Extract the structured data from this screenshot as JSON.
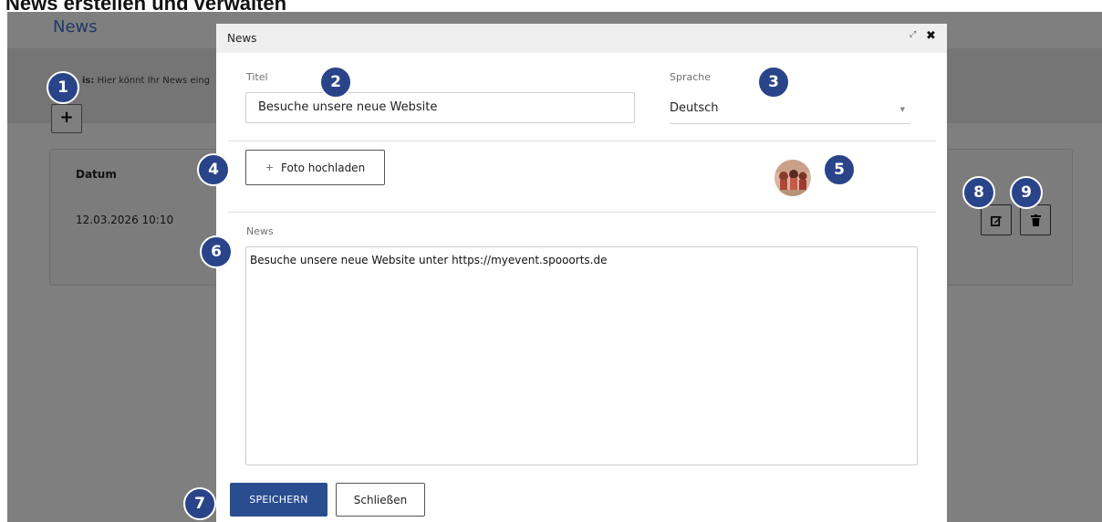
{
  "page": {
    "heading": "News erstellen und verwalten"
  },
  "background": {
    "title": "News",
    "hint_label": "is:",
    "hint_text": " Hier könnt Ihr News eing",
    "add_button_icon": "plus-icon",
    "table": {
      "column_header": "Datum",
      "rows": [
        {
          "date": "12.03.2026 10:10"
        }
      ]
    },
    "row_actions": {
      "edit_icon": "edit-icon",
      "delete_icon": "trash-icon"
    }
  },
  "modal": {
    "title": "News",
    "header_icons": [
      "external-link-icon",
      "close-icon"
    ],
    "fields": {
      "title_label": "Titel",
      "title_value": "Besuche unsere neue Website",
      "language_label": "Sprache",
      "language_value": "Deutsch",
      "news_label": "News",
      "news_value": "Besuche unsere neue Website unter https://myevent.spooorts.de"
    },
    "upload_button_label": "Foto hochladen",
    "save_button_label": "SPEICHERN",
    "close_button_label": "Schließen"
  },
  "markers": [
    "1",
    "2",
    "3",
    "4",
    "5",
    "6",
    "7",
    "8",
    "9"
  ],
  "colors": {
    "accent": "#2a4d8f",
    "marker": "#2a4489",
    "overlay": "#7f7f7f"
  }
}
